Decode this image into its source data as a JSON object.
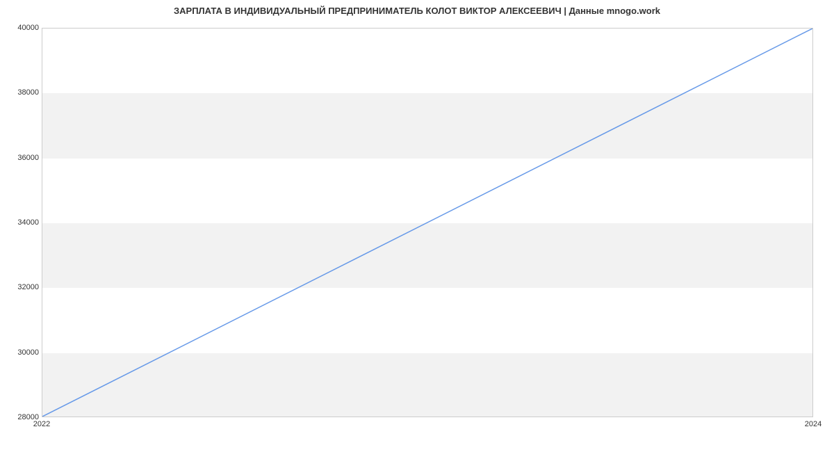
{
  "chart_data": {
    "type": "line",
    "title": "ЗАРПЛАТА В ИНДИВИДУАЛЬНЫЙ ПРЕДПРИНИМАТЕЛЬ КОЛОТ ВИКТОР АЛЕКСЕЕВИЧ | Данные mnogo.work",
    "xlabel": "",
    "ylabel": "",
    "x": [
      2022,
      2024
    ],
    "values": [
      28000,
      40000
    ],
    "xlim": [
      2022,
      2024
    ],
    "ylim": [
      28000,
      40000
    ],
    "x_ticks": [
      2022,
      2024
    ],
    "y_ticks": [
      28000,
      30000,
      32000,
      34000,
      36000,
      38000,
      40000
    ],
    "line_color": "#6699e8",
    "grid_band_color": "#f2f2f2"
  }
}
